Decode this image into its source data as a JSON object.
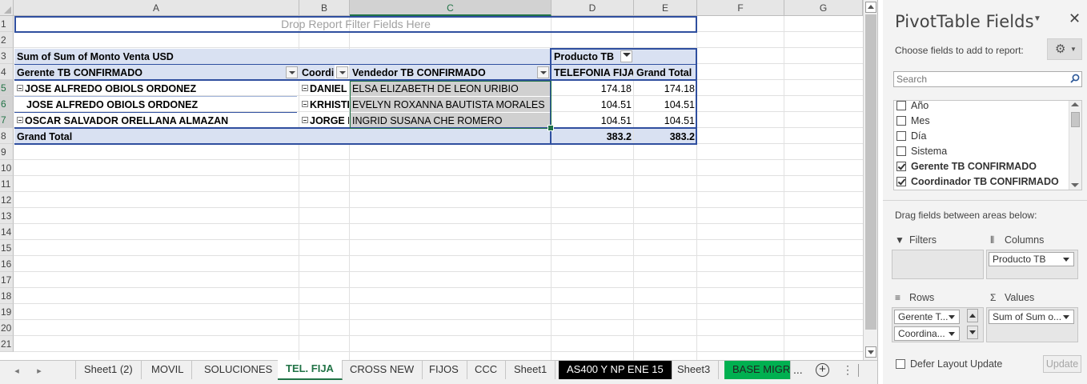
{
  "columns": [
    "A",
    "B",
    "C",
    "D",
    "E",
    "F",
    "G"
  ],
  "rows": [
    "1",
    "2",
    "3",
    "4",
    "5",
    "6",
    "7",
    "8",
    "9",
    "10",
    "11",
    "12",
    "13",
    "14",
    "15",
    "16",
    "17",
    "18",
    "19",
    "20",
    "21"
  ],
  "pivot": {
    "drop_filter_text": "Drop Report Filter Fields Here",
    "values_header": "Sum of Sum of Monto Venta USD",
    "column_field": "Producto TB",
    "row_field_1": "Gerente TB CONFIRMADO",
    "row_field_2": "Coordinador TB CONFIRMADO",
    "row_field_3": "Vendedor TB CONFIRMADO",
    "col_item_1": "TELEFONIA FIJA",
    "grand_total_header": "Grand Total",
    "data_rows": [
      {
        "gerente": "JOSE ALFREDO OBIOLS ORDONEZ",
        "coordinador": "DANIEL",
        "vendedor": "ELSA ELIZABETH DE LEON URIBIO",
        "value": "174.18",
        "total": "174.18"
      },
      {
        "gerente": "JOSE ALFREDO OBIOLS ORDONEZ",
        "coordinador": "KRHISTE",
        "vendedor": "EVELYN ROXANNA BAUTISTA MORALES",
        "value": "104.51",
        "total": "104.51"
      },
      {
        "gerente": "OSCAR SALVADOR ORELLANA ALMAZAN",
        "coordinador": "JORGE L",
        "vendedor": "INGRID SUSANA CHE ROMERO",
        "value": "104.51",
        "total": "104.51"
      }
    ],
    "grand_total_label": "Grand Total",
    "grand_total_value": "383.2",
    "grand_total_total": "383.2"
  },
  "tabs": [
    {
      "label": "Sheet1 (2)",
      "style": "normal"
    },
    {
      "label": "MOVIL",
      "style": "normal"
    },
    {
      "label": "SOLUCIONES",
      "style": "normal"
    },
    {
      "label": "TEL. FIJA",
      "style": "active"
    },
    {
      "label": "CROSS NEW",
      "style": "normal"
    },
    {
      "label": "FIJOS",
      "style": "normal"
    },
    {
      "label": "CCC",
      "style": "normal"
    },
    {
      "label": "Sheet1",
      "style": "normal"
    },
    {
      "label": "AS400 Y NP ENE 15",
      "style": "black"
    },
    {
      "label": "Sheet3",
      "style": "normal"
    },
    {
      "label": "BASE MIGRA",
      "style": "green"
    }
  ],
  "tabbar": {
    "more": "...",
    "add": "+",
    "menu": "⋮"
  },
  "pane": {
    "title": "PivotTable Fields",
    "choose_label": "Choose fields to add to report:",
    "search_placeholder": "Search",
    "fields": [
      {
        "label": "Año",
        "checked": false
      },
      {
        "label": "Mes",
        "checked": false
      },
      {
        "label": "Día",
        "checked": false
      },
      {
        "label": "Sistema",
        "checked": false
      },
      {
        "label": "Gerente TB CONFIRMADO",
        "checked": true
      },
      {
        "label": "Coordinador TB CONFIRMADO",
        "checked": true
      }
    ],
    "drag_label": "Drag fields between areas below:",
    "filters_label": "Filters",
    "columns_label": "Columns",
    "rows_label": "Rows",
    "values_label": "Values",
    "columns_chip": "Producto TB",
    "rows_chip_1": "Gerente T...",
    "rows_chip_2": "Coordina...",
    "values_chip": "Sum of Sum o...",
    "defer_label": "Defer Layout Update",
    "update_label": "Update"
  },
  "colors": {
    "accent": "#217346",
    "pivot_border": "#2f4f9f",
    "pivot_header_fill": "#d9e1f2"
  }
}
